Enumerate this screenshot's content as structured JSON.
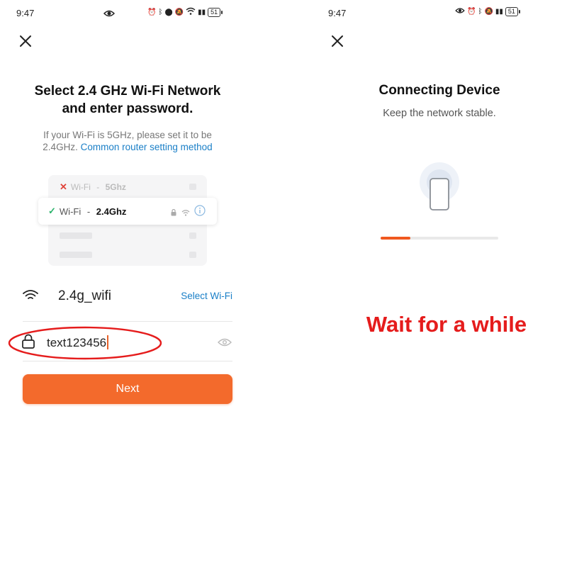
{
  "left": {
    "status": {
      "time": "9:47",
      "battery": "51"
    },
    "title_line1": "Select 2.4 GHz Wi-Fi Network",
    "title_line2": "and enter password.",
    "hint_text_line1": "If your Wi-Fi is 5GHz, please set it to be",
    "hint_text_line2": "2.4GHz.",
    "hint_link": "Common router setting method",
    "illustration": {
      "row1": {
        "label": "Wi-Fi",
        "band": "5Ghz"
      },
      "row2": {
        "label": "Wi-Fi",
        "band": "2.4Ghz"
      },
      "separator": " - "
    },
    "wifi_field": {
      "ssid": "2.4g_wifi",
      "select_label": "Select Wi-Fi"
    },
    "password_field": {
      "value": "text123456"
    },
    "next_label": "Next"
  },
  "right": {
    "status": {
      "time": "9:47",
      "battery": "51"
    },
    "title": "Connecting Device",
    "subtitle": "Keep the network stable.",
    "progress": 0.25,
    "annotation": "Wait for a while"
  },
  "colors": {
    "accent": "#f36a2c",
    "link": "#1a7fc7",
    "annotation_red": "#e51c1c",
    "success_green": "#2bb36b",
    "error_red": "#e0443a"
  }
}
